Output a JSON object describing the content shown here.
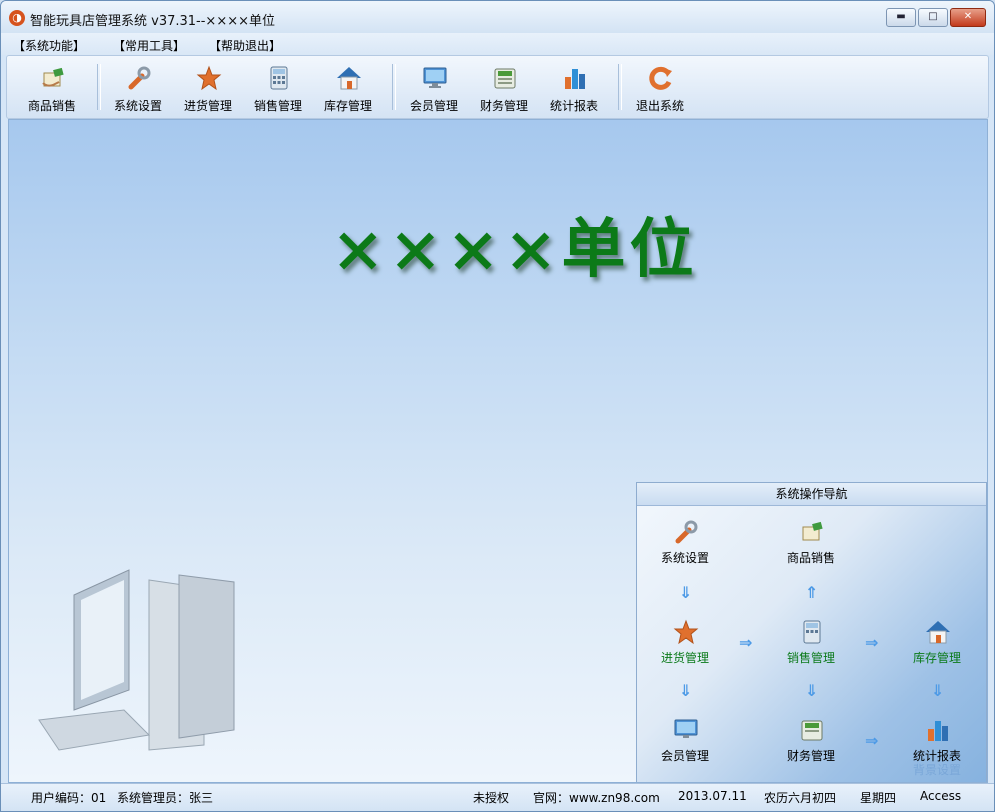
{
  "window": {
    "title": "智能玩具店管理系统 v37.31--××××单位",
    "buttons": {
      "minimize": "▬",
      "restore": "□",
      "close": "✕"
    }
  },
  "menu": [
    "【系统功能】",
    "【常用工具】",
    "【帮助退出】"
  ],
  "toolbar": {
    "items": [
      {
        "label": "商品销售",
        "icon": "hand-bill-icon"
      },
      {
        "label": "系统设置",
        "icon": "wrench-icon"
      },
      {
        "label": "进货管理",
        "icon": "star-icon"
      },
      {
        "label": "销售管理",
        "icon": "calculator-icon"
      },
      {
        "label": "库存管理",
        "icon": "house-icon"
      },
      {
        "label": "会员管理",
        "icon": "monitor-icon"
      },
      {
        "label": "财务管理",
        "icon": "cash-register-icon"
      },
      {
        "label": "统计报表",
        "icon": "bar-chart-icon"
      },
      {
        "label": "退出系统",
        "icon": "exit-arrow-icon"
      }
    ]
  },
  "main": {
    "unit_title": "××××单位"
  },
  "nav": {
    "title": "系统操作导航",
    "nodes": {
      "system_settings": "系统设置",
      "product_sales": "商品销售",
      "purchase": "进货管理",
      "sales": "销售管理",
      "inventory": "库存管理",
      "member": "会员管理",
      "finance": "财务管理",
      "reports": "统计报表"
    },
    "background_setting": "背景设置"
  },
  "status": {
    "user_code": "用户编码：01",
    "admin": "系统管理员：张三",
    "license": "未授权",
    "website": "官网：www.zn98.com",
    "date": "2013.07.11",
    "lunar": "农历六月初四",
    "weekday": "星期四",
    "db": "Access"
  },
  "colors": {
    "title_green": "#0c7a18",
    "accent_blue": "#4d9ae6"
  }
}
